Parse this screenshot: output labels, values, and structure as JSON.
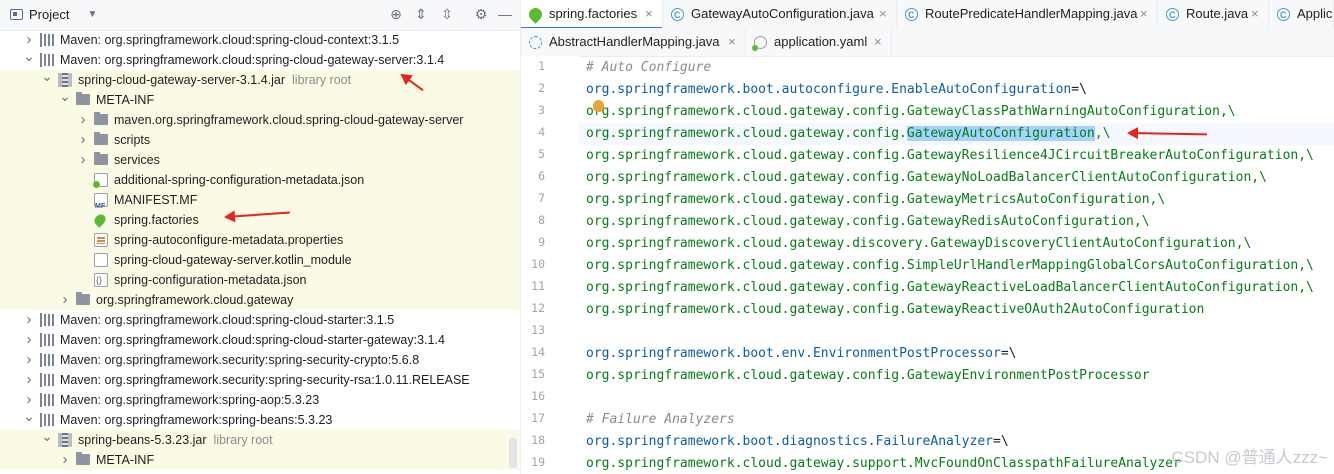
{
  "project_panel": {
    "title": "Project",
    "tree": [
      {
        "label": "Maven: org.springframework.cloud:spring-cloud-context:3.1.5",
        "icon": "library-icon",
        "chevron": "right"
      },
      {
        "label": "Maven: org.springframework.cloud:spring-cloud-gateway-server:3.1.4",
        "icon": "library-icon",
        "chevron": "down"
      },
      {
        "label": "spring-cloud-gateway-server-3.1.4.jar",
        "hint": "library root",
        "icon": "jar-icon",
        "chevron": "down"
      },
      {
        "label": "META-INF",
        "icon": "folder-icon",
        "chevron": "down"
      },
      {
        "label": "maven.org.springframework.cloud.spring-cloud-gateway-server",
        "icon": "folder-icon",
        "chevron": "right"
      },
      {
        "label": "scripts",
        "icon": "folder-icon",
        "chevron": "right"
      },
      {
        "label": "services",
        "icon": "folder-icon",
        "chevron": "right"
      },
      {
        "label": "additional-spring-configuration-metadata.json",
        "icon": "spring-json-icon",
        "chevron": ""
      },
      {
        "label": "MANIFEST.MF",
        "icon": "manifest-icon",
        "chevron": ""
      },
      {
        "label": "spring.factories",
        "icon": "spring-icon",
        "chevron": ""
      },
      {
        "label": "spring-autoconfigure-metadata.properties",
        "icon": "properties-icon",
        "chevron": ""
      },
      {
        "label": "spring-cloud-gateway-server.kotlin_module",
        "icon": "file-icon",
        "chevron": ""
      },
      {
        "label": "spring-configuration-metadata.json",
        "icon": "json-icon",
        "chevron": ""
      },
      {
        "label": "org.springframework.cloud.gateway",
        "icon": "folder-icon",
        "chevron": "right"
      },
      {
        "label": "Maven: org.springframework.cloud:spring-cloud-starter:3.1.5",
        "icon": "library-icon",
        "chevron": "right"
      },
      {
        "label": "Maven: org.springframework.cloud:spring-cloud-starter-gateway:3.1.4",
        "icon": "library-icon",
        "chevron": "right"
      },
      {
        "label": "Maven: org.springframework.security:spring-security-crypto:5.6.8",
        "icon": "library-icon",
        "chevron": "right"
      },
      {
        "label": "Maven: org.springframework.security:spring-security-rsa:1.0.11.RELEASE",
        "icon": "library-icon",
        "chevron": "right"
      },
      {
        "label": "Maven: org.springframework:spring-aop:5.3.23",
        "icon": "library-icon",
        "chevron": "right"
      },
      {
        "label": "Maven: org.springframework:spring-beans:5.3.23",
        "icon": "library-icon",
        "chevron": "down"
      },
      {
        "label": "spring-beans-5.3.23.jar",
        "hint": "library root",
        "icon": "jar-icon",
        "chevron": "down"
      },
      {
        "label": "META-INF",
        "icon": "folder-icon",
        "chevron": "right"
      }
    ]
  },
  "editor": {
    "tabs_row1": [
      {
        "label": "spring.factories",
        "icon": "spring-icon",
        "active": true,
        "close": "×"
      },
      {
        "label": "GatewayAutoConfiguration.java",
        "icon": "java-class-icon",
        "active": false,
        "close": "×"
      },
      {
        "label": "RoutePredicateHandlerMapping.java",
        "icon": "java-class-icon",
        "active": false,
        "close": "×"
      },
      {
        "label": "Route.java",
        "icon": "java-class-icon",
        "active": false,
        "close": "×"
      },
      {
        "label": "Applic",
        "icon": "java-class-icon",
        "active": false,
        "close": ""
      }
    ],
    "tabs_row2": [
      {
        "label": "AbstractHandlerMapping.java",
        "icon": "java-abstract-icon",
        "active": false,
        "close": "×"
      },
      {
        "label": "application.yaml",
        "icon": "yaml-icon",
        "active": false,
        "close": "×"
      }
    ],
    "lines": [
      {
        "n": "1",
        "parts": [
          {
            "t": "# Auto Configure",
            "c": "comment"
          }
        ]
      },
      {
        "n": "2",
        "parts": [
          {
            "t": "org.springframework.boot.autoconfigure.EnableAutoConfiguration",
            "c": "key"
          },
          {
            "t": "=\\",
            "c": "op"
          }
        ]
      },
      {
        "n": "3",
        "parts": [
          {
            "t": "org.springframework.cloud.gateway.config.GatewayClassPathWarningAutoConfiguration,\\",
            "c": "val"
          }
        ]
      },
      {
        "n": "4",
        "parts": [
          {
            "t": "org.springframework.cloud.gateway.config.",
            "c": "val"
          },
          {
            "t": "GatewayAutoConfiguration",
            "c": "val",
            "sel": true
          },
          {
            "t": ",\\",
            "c": "val"
          }
        ]
      },
      {
        "n": "5",
        "parts": [
          {
            "t": "org.springframework.cloud.gateway.config.GatewayResilience4JCircuitBreakerAutoConfiguration,\\",
            "c": "val"
          }
        ]
      },
      {
        "n": "6",
        "parts": [
          {
            "t": "org.springframework.cloud.gateway.config.GatewayNoLoadBalancerClientAutoConfiguration,\\",
            "c": "val"
          }
        ]
      },
      {
        "n": "7",
        "parts": [
          {
            "t": "org.springframework.cloud.gateway.config.GatewayMetricsAutoConfiguration,\\",
            "c": "val"
          }
        ]
      },
      {
        "n": "8",
        "parts": [
          {
            "t": "org.springframework.cloud.gateway.config.GatewayRedisAutoConfiguration,\\",
            "c": "val"
          }
        ]
      },
      {
        "n": "9",
        "parts": [
          {
            "t": "org.springframework.cloud.gateway.discovery.GatewayDiscoveryClientAutoConfiguration,\\",
            "c": "val"
          }
        ]
      },
      {
        "n": "10",
        "parts": [
          {
            "t": "org.springframework.cloud.gateway.config.SimpleUrlHandlerMappingGlobalCorsAutoConfiguration,\\",
            "c": "val"
          }
        ]
      },
      {
        "n": "11",
        "parts": [
          {
            "t": "org.springframework.cloud.gateway.config.GatewayReactiveLoadBalancerClientAutoConfiguration,\\",
            "c": "val"
          }
        ]
      },
      {
        "n": "12",
        "parts": [
          {
            "t": "org.springframework.cloud.gateway.config.GatewayReactiveOAuth2AutoConfiguration",
            "c": "val"
          }
        ]
      },
      {
        "n": "13",
        "parts": []
      },
      {
        "n": "14",
        "parts": [
          {
            "t": "org.springframework.boot.env.EnvironmentPostProcessor",
            "c": "key"
          },
          {
            "t": "=\\",
            "c": "op"
          }
        ]
      },
      {
        "n": "15",
        "parts": [
          {
            "t": "org.springframework.cloud.gateway.config.GatewayEnvironmentPostProcessor",
            "c": "val"
          }
        ]
      },
      {
        "n": "16",
        "parts": []
      },
      {
        "n": "17",
        "parts": [
          {
            "t": "# Failure Analyzers",
            "c": "comment"
          }
        ]
      },
      {
        "n": "18",
        "parts": [
          {
            "t": "org.springframework.boot.diagnostics.FailureAnalyzer",
            "c": "key"
          },
          {
            "t": "=\\",
            "c": "op"
          }
        ]
      },
      {
        "n": "19",
        "parts": [
          {
            "t": "org.springframework.cloud.gateway.support.MvcFoundOnClasspathFailureAnalyzer",
            "c": "val"
          }
        ]
      }
    ]
  },
  "watermark": "CSDN @普通人zzz~",
  "colors": {
    "accent": "#3574f0",
    "arrow": "#e8231c",
    "key": "#0e5ca8",
    "value": "#067d17",
    "comment": "#8c8c8c",
    "selection": "#a6d2ff",
    "row_highlight": "#fbfae5"
  }
}
